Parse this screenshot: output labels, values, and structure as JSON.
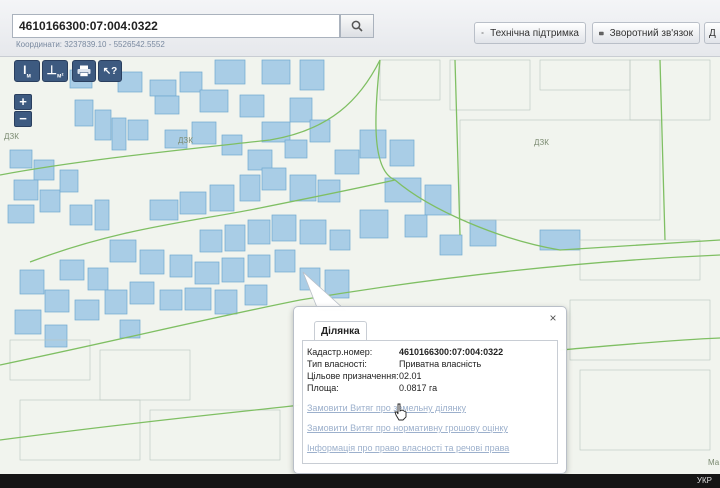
{
  "search": {
    "value": "4610166300:07:004:0322"
  },
  "coords_text": "Координати: 3237839.10 - 5526542.5552",
  "toolbar": {
    "support_label": "Технічна підтримка",
    "feedback_label": "Зворотний зв'язок",
    "extra_label": "Д"
  },
  "tools": [
    {
      "name": "length-measure-tool",
      "glyph": "I",
      "sub": "м"
    },
    {
      "name": "area-measure-tool",
      "glyph": "⊥",
      "sub": "м²"
    },
    {
      "name": "print-tool",
      "glyph": "🖨"
    },
    {
      "name": "identify-tool",
      "glyph": "↖?"
    }
  ],
  "zoom": {
    "in": "+",
    "out": "−"
  },
  "map_labels": [
    "ДЗК",
    "ДЗК",
    "ДЗК",
    "Ма"
  ],
  "popup": {
    "tab": "Ділянка",
    "close": "×",
    "rows": [
      {
        "label": "Кадастр.номер:",
        "value": "4610166300:07:004:0322"
      },
      {
        "label": "Тип власності:",
        "value": "Приватна власність"
      },
      {
        "label": "Цільове призначення:",
        "value": "02.01"
      },
      {
        "label": "Площа:",
        "value": "0.0817 га"
      }
    ],
    "links": [
      "Замовити Витяг про земельну ділянку",
      "Замовити Витяг про нормативну грошову оцінку",
      "Інформація про право власності та речові права"
    ]
  },
  "taskbar": {
    "clock": "УКР"
  }
}
